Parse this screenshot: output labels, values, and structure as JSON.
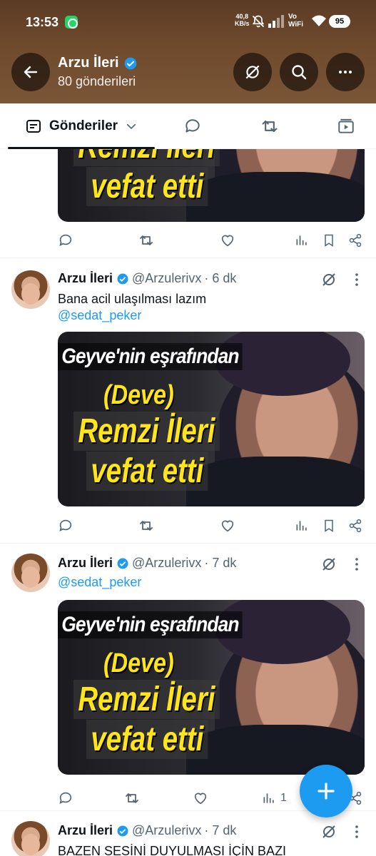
{
  "status_bar": {
    "time": "13:53",
    "net_speed_value": "40,8",
    "net_speed_unit": "KB/s",
    "vowifi_line1": "Vo",
    "vowifi_line2": "WiFi",
    "battery": "95"
  },
  "header": {
    "name": "Arzu İleri",
    "post_count": "80 gönderileri",
    "accent": "#1d9bf0"
  },
  "tabs": {
    "posts_label": "Gönderiler",
    "icons": [
      "posts-icon",
      "replies-icon",
      "reposts-icon",
      "media-icon"
    ]
  },
  "media_caption": {
    "line1": "Geyve'nin eşrafından",
    "line2": "(Deve)",
    "line3": "Remzi İleri",
    "line4": "vefat etti"
  },
  "tweets": [
    {
      "name": "Arzu İleri",
      "handle": "@Arzulerivx",
      "time": "· 6 dk",
      "text": "Bana acil ulaşılması lazım",
      "mention": "@sedat_peker",
      "view_count": ""
    },
    {
      "name": "Arzu İleri",
      "handle": "@Arzulerivx",
      "time": "· 7 dk",
      "text": "",
      "mention": "@sedat_peker",
      "view_count": "1"
    },
    {
      "name": "Arzu İleri",
      "handle": "@Arzulerivx",
      "time": "· 7 dk",
      "text": "BAZEN SESİNİ DUYULMASI İÇİN BAZI",
      "mention": "",
      "view_count": ""
    }
  ]
}
